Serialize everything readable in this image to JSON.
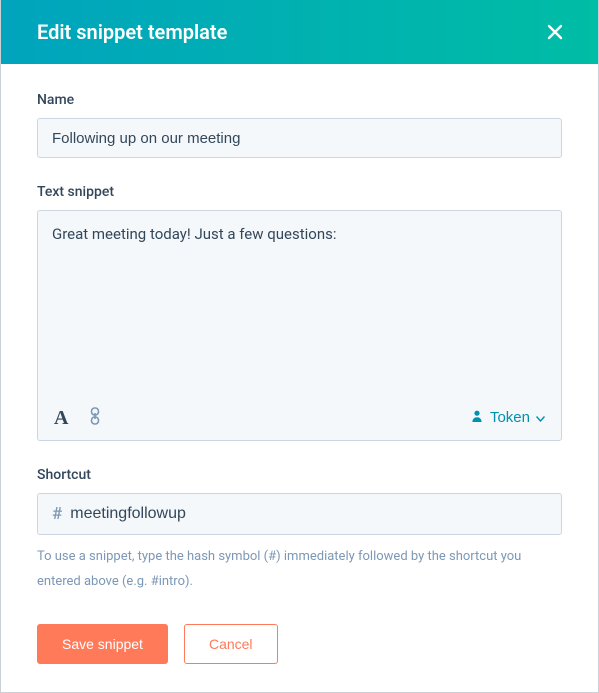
{
  "modal": {
    "title": "Edit snippet template"
  },
  "fields": {
    "name": {
      "label": "Name",
      "value": "Following up on our meeting"
    },
    "snippet": {
      "label": "Text snippet",
      "value": "Great meeting today! Just a few questions:"
    },
    "shortcut": {
      "label": "Shortcut",
      "prefix": "#",
      "value": "meetingfollowup",
      "help": "To use a snippet, type the hash symbol (#) immediately followed by the shortcut you entered above (e.g. #intro)."
    }
  },
  "toolbar": {
    "token_label": "Token"
  },
  "actions": {
    "save_label": "Save snippet",
    "cancel_label": "Cancel"
  }
}
